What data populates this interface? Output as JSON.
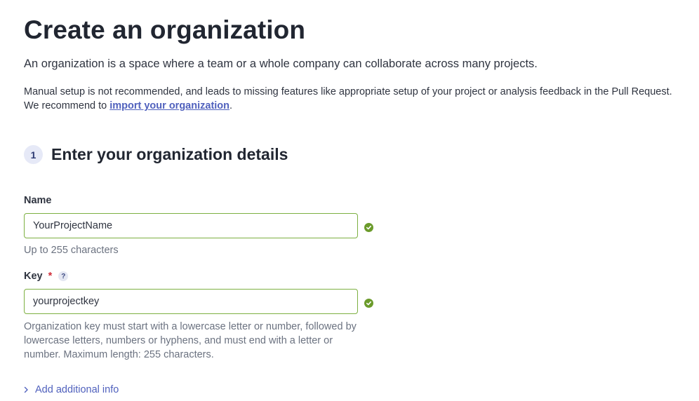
{
  "page": {
    "title": "Create an organization",
    "intro": "An organization is a space where a team or a whole company can collaborate across many projects.",
    "warning_line1": "Manual setup is not recommended, and leads to missing features like appropriate setup of your project or analysis feedback in the Pull Request.",
    "warning_line2_prefix": "We recommend to ",
    "warning_link": "import your organization",
    "warning_line2_suffix": "."
  },
  "step": {
    "number": "1",
    "title": "Enter your organization details"
  },
  "form": {
    "name": {
      "label": "Name",
      "value": "YourProjectName",
      "hint": "Up to 255 characters",
      "status": "valid"
    },
    "key": {
      "label": "Key",
      "required_mark": "*",
      "help_glyph": "?",
      "value": "yourprojectkey",
      "hint_lines": [
        "Organization key must start with a lowercase letter or number, followed by",
        "lowercase letters, numbers or hyphens, and must end with a letter or",
        "number. Maximum length: 255 characters."
      ],
      "status": "valid"
    },
    "additional_info": "Add additional info"
  },
  "icons": {
    "valid": "check-circle-icon",
    "help": "question-circle-icon",
    "expand": "chevron-right-icon"
  },
  "colors": {
    "accent": "#5061bd",
    "valid": "#6b9b2b",
    "valid_border": "#7db041",
    "required": "#d02f3a"
  }
}
